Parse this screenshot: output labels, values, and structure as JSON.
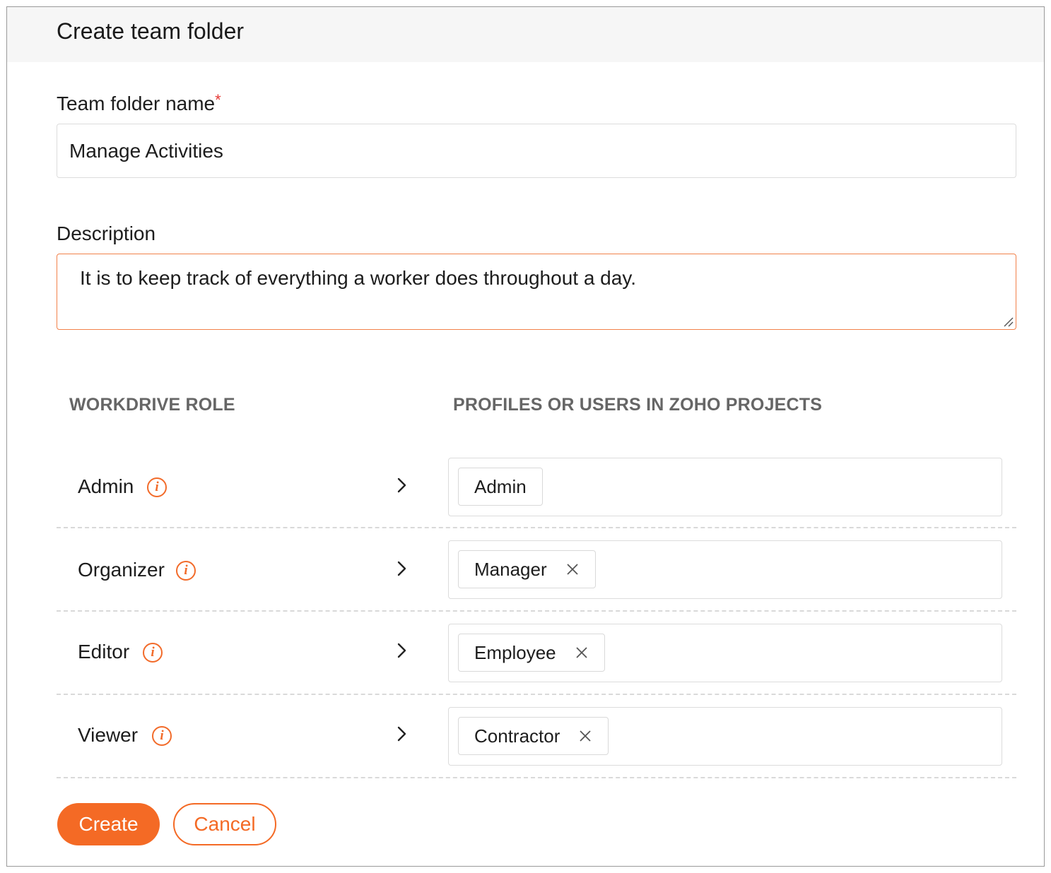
{
  "dialog": {
    "title": "Create team folder"
  },
  "name_field": {
    "label": "Team folder name",
    "required_marker": "*",
    "value": "Manage Activities"
  },
  "description_field": {
    "label": "Description",
    "value": "It is to keep track of everything a worker does throughout a day."
  },
  "mapping": {
    "role_header": "WORKDRIVE ROLE",
    "profiles_header": "PROFILES OR USERS IN ZOHO PROJECTS",
    "rows": [
      {
        "role": "Admin",
        "info_icon": "info-icon",
        "profile": "Admin",
        "removable": false
      },
      {
        "role": "Organizer",
        "info_icon": "info-icon",
        "profile": "Manager",
        "removable": true
      },
      {
        "role": "Editor",
        "info_icon": "info-icon",
        "profile": "Employee",
        "removable": true
      },
      {
        "role": "Viewer",
        "info_icon": "info-icon",
        "profile": "Contractor",
        "removable": true
      }
    ]
  },
  "actions": {
    "create_label": "Create",
    "cancel_label": "Cancel"
  },
  "colors": {
    "accent": "#f46a25",
    "focus_border": "#f2814a",
    "required": "#e53935",
    "header_bg": "#f6f6f6",
    "column_header_text": "#666666"
  }
}
